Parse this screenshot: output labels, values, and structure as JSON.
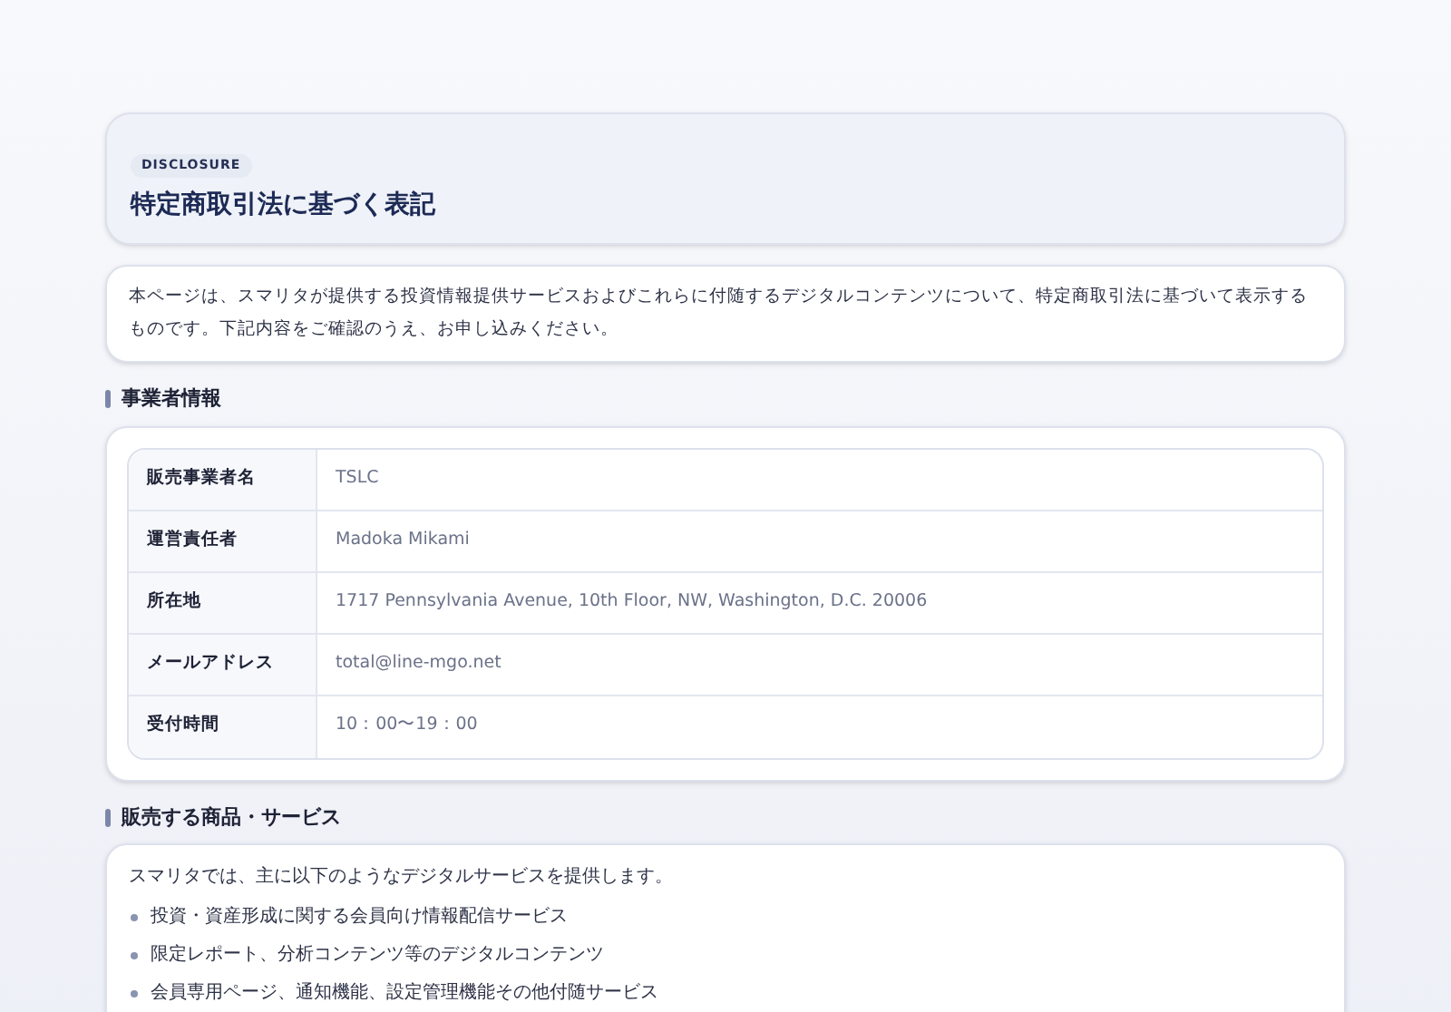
{
  "header": {
    "badge": "DISCLOSURE",
    "title": "特定商取引法に基づく表記"
  },
  "intro": "本ページは、スマリタが提供する投資情報提供サービスおよびこれらに付随するデジタルコンテンツについて、特定商取引法に基づいて表示するものです。下記内容をご確認のうえ、お申し込みください。",
  "business_section": {
    "heading": "事業者情報",
    "rows": [
      {
        "label": "販売事業者名",
        "value": "TSLC"
      },
      {
        "label": "運営責任者",
        "value": "Madoka Mikami"
      },
      {
        "label": "所在地",
        "value": "1717 Pennsylvania Avenue, 10th Floor, NW, Washington, D.C. 20006"
      },
      {
        "label": "メールアドレス",
        "value": "total@line-mgo.net"
      },
      {
        "label": "受付時間",
        "value": "10：00〜19：00"
      }
    ]
  },
  "products_section": {
    "heading": "販売する商品・サービス",
    "lead": "スマリタでは、主に以下のようなデジタルサービスを提供します。",
    "items": [
      "投資・資産形成に関する会員向け情報配信サービス",
      "限定レポート、分析コンテンツ等のデジタルコンテンツ",
      "会員専用ページ、通知機能、設定管理機能その他付随サービス"
    ]
  }
}
